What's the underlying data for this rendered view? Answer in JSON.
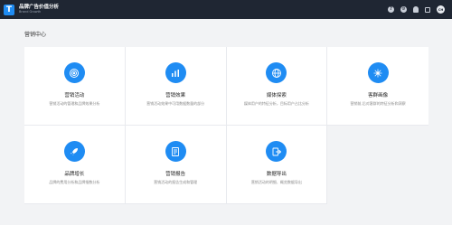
{
  "header": {
    "logo_letter": "T",
    "title": "品牌广告价值分析",
    "subtitle": "Brand Growth",
    "icons": [
      "help-icon",
      "settings-icon",
      "bell-icon",
      "apps-icon"
    ],
    "avatar_text": "CH"
  },
  "page": {
    "section_title": "营销中心"
  },
  "cards": [
    {
      "title": "营销活动",
      "desc": "营销活动的管理和品牌效果分析",
      "icon": "target-icon"
    },
    {
      "title": "营销效果",
      "desc": "营销活动效果中可用数据数量的部分",
      "icon": "bar-chart-icon"
    },
    {
      "title": "媒体探索",
      "desc": "媒体用户的特征分析，目标用户占比分析",
      "icon": "globe-icon"
    },
    {
      "title": "客群画像",
      "desc": "营销前,后对客群的特征分析和洞察",
      "icon": "network-icon"
    },
    {
      "title": "品牌增长",
      "desc": "品牌的费用分析和品牌指数分析",
      "icon": "rocket-icon"
    },
    {
      "title": "营销报告",
      "desc": "营销活动的报告生成和管理",
      "icon": "report-icon"
    },
    {
      "title": "数据导出",
      "desc": "营销活动的明细、概览数据导出",
      "icon": "export-icon"
    }
  ],
  "colors": {
    "topbar": "#1f2633",
    "accent": "#1f8cf3",
    "background": "#f2f3f5"
  }
}
